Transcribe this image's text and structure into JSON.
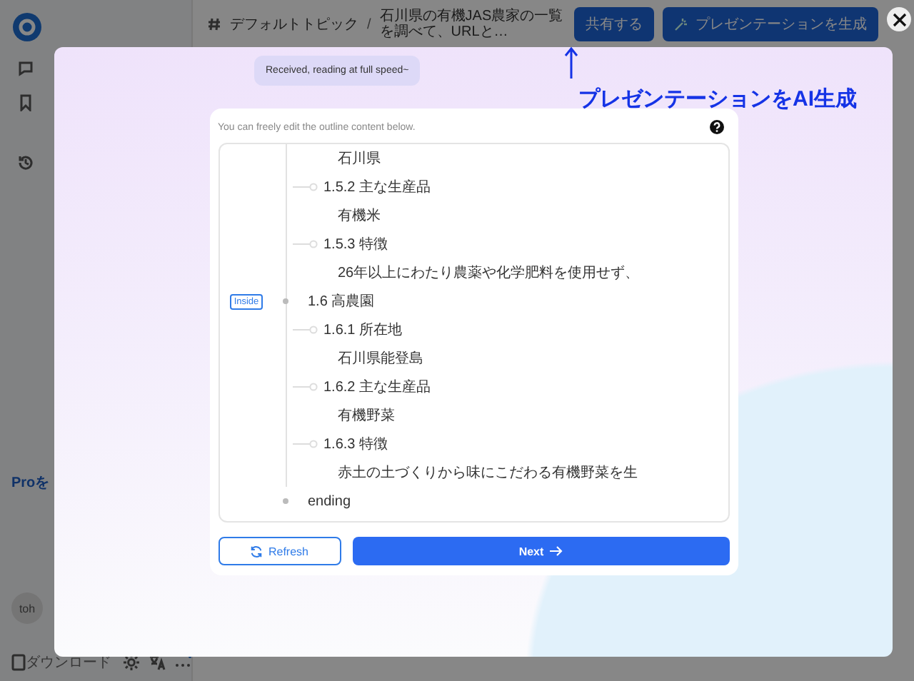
{
  "sidebar": {
    "promo_title": "Proを",
    "avatar": "toh",
    "download": "ダウンロード"
  },
  "header": {
    "breadcrumb": "デフォルトトピック",
    "separator": "/",
    "title": "石川県の有機JAS農家の一覧を調べて、URLと…",
    "buttons": [
      {
        "label": "共有する",
        "kind": "plain"
      },
      {
        "label": "プレゼンテーションを生成",
        "kind": "generate"
      }
    ]
  },
  "annotation": "プレゼンテーションをAI生成",
  "dialog": {
    "status_message": "Received, reading at full speed~",
    "hint": "You can freely edit the outline content below.",
    "outline": [
      {
        "children": [
          {
            "children": [
              {
                "label": "石川県"
              }
            ]
          },
          {
            "label": "1.5.2 主な生産品",
            "children": [
              {
                "label": "有機米"
              }
            ]
          },
          {
            "label": "1.5.3 特徴",
            "children": [
              {
                "label": "26年以上にわたり農薬や化学肥料を使用せず、"
              }
            ]
          }
        ]
      },
      {
        "label": "1.6 高農園",
        "badge": "Inside",
        "children": [
          {
            "label": "1.6.1 所在地",
            "children": [
              {
                "label": "石川県能登島"
              }
            ]
          },
          {
            "label": "1.6.2 主な生産品",
            "children": [
              {
                "label": "有機野菜"
              }
            ]
          },
          {
            "label": "1.6.3 特徴",
            "children": [
              {
                "label": "赤土の土づくりから味にこだわる有機野菜を生"
              }
            ]
          }
        ]
      },
      {
        "label": "ending"
      }
    ],
    "buttons": [
      {
        "label": "Refresh",
        "kind": "refresh"
      },
      {
        "label": "Next",
        "kind": "next"
      }
    ]
  }
}
